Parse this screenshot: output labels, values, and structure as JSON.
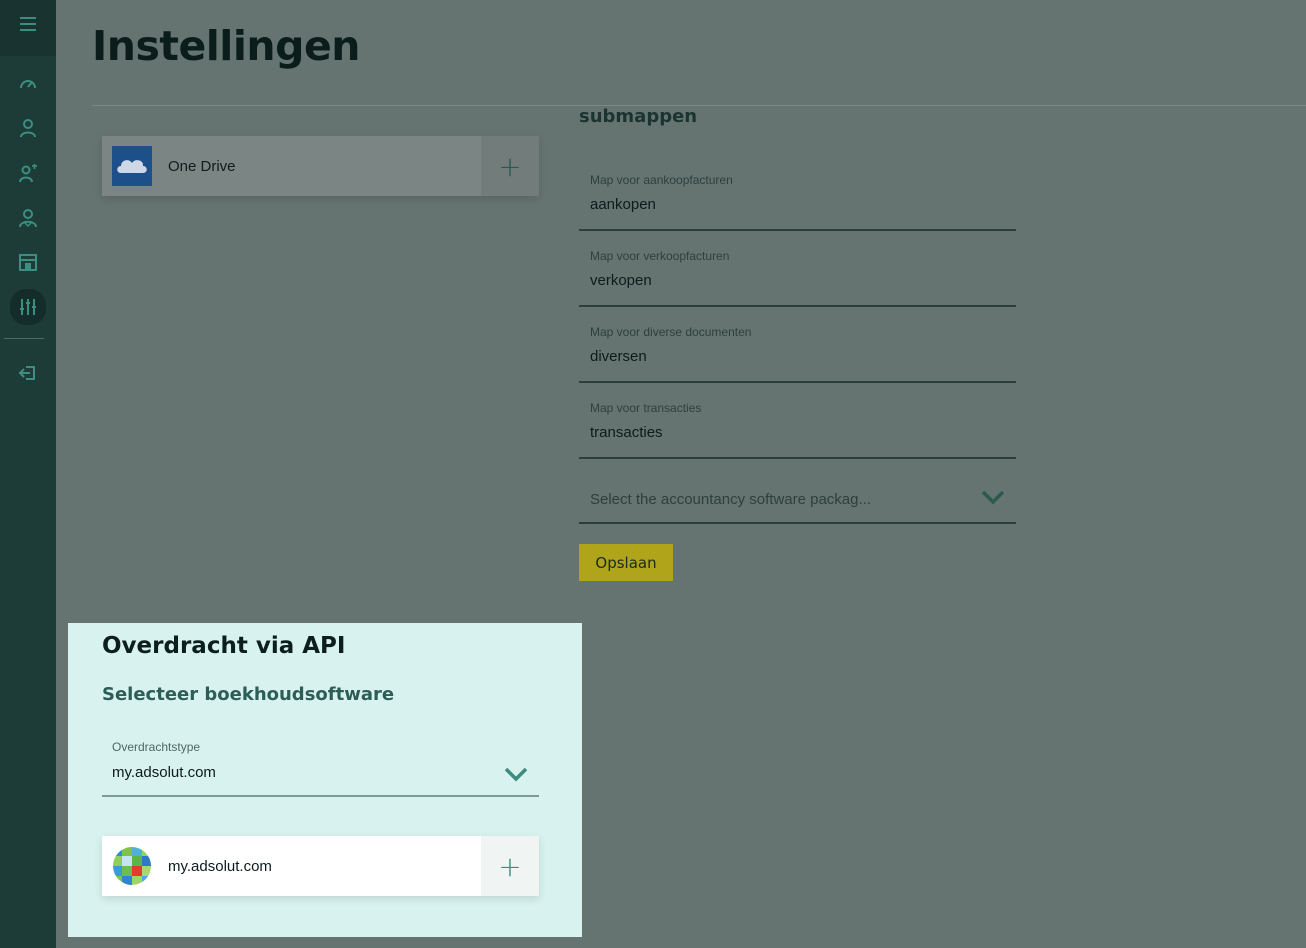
{
  "page": {
    "title": "Instellingen"
  },
  "sidebar": {
    "items": [
      {
        "icon": "menu-icon"
      },
      {
        "icon": "speedometer-icon"
      },
      {
        "icon": "user-icon"
      },
      {
        "icon": "user-plus-icon"
      },
      {
        "icon": "users-icon"
      },
      {
        "icon": "store-icon"
      },
      {
        "icon": "sliders-icon",
        "active": true
      },
      {
        "icon": "logout-icon"
      }
    ]
  },
  "storage": {
    "provider": {
      "label": "One Drive",
      "icon": "onedrive-icon",
      "add": "+"
    }
  },
  "subfolders": {
    "title": "submappen",
    "fields": [
      {
        "label": "Map voor aankoopfacturen",
        "value": "aankopen"
      },
      {
        "label": "Map voor verkoopfacturen",
        "value": "verkopen"
      },
      {
        "label": "Map voor diverse documenten",
        "value": "diversen"
      },
      {
        "label": "Map voor transacties",
        "value": "transacties"
      }
    ],
    "software_select": {
      "placeholder": "Select the accountancy software packag..."
    },
    "save_label": "Opslaan"
  },
  "api": {
    "title": "Overdracht via API",
    "subtitle": "Selecteer boekhoudsoftware",
    "type_field": {
      "label": "Overdrachtstype",
      "value": "my.adsolut.com"
    },
    "connector": {
      "label": "my.adsolut.com",
      "icon": "adsolut-icon",
      "add": "+"
    }
  },
  "colors": {
    "sidebar": "#1d3b37",
    "overlay": "#657371",
    "accent": "#3d8c7d",
    "save_button": "#b0a51a",
    "api_panel": "#d8f2ef"
  }
}
